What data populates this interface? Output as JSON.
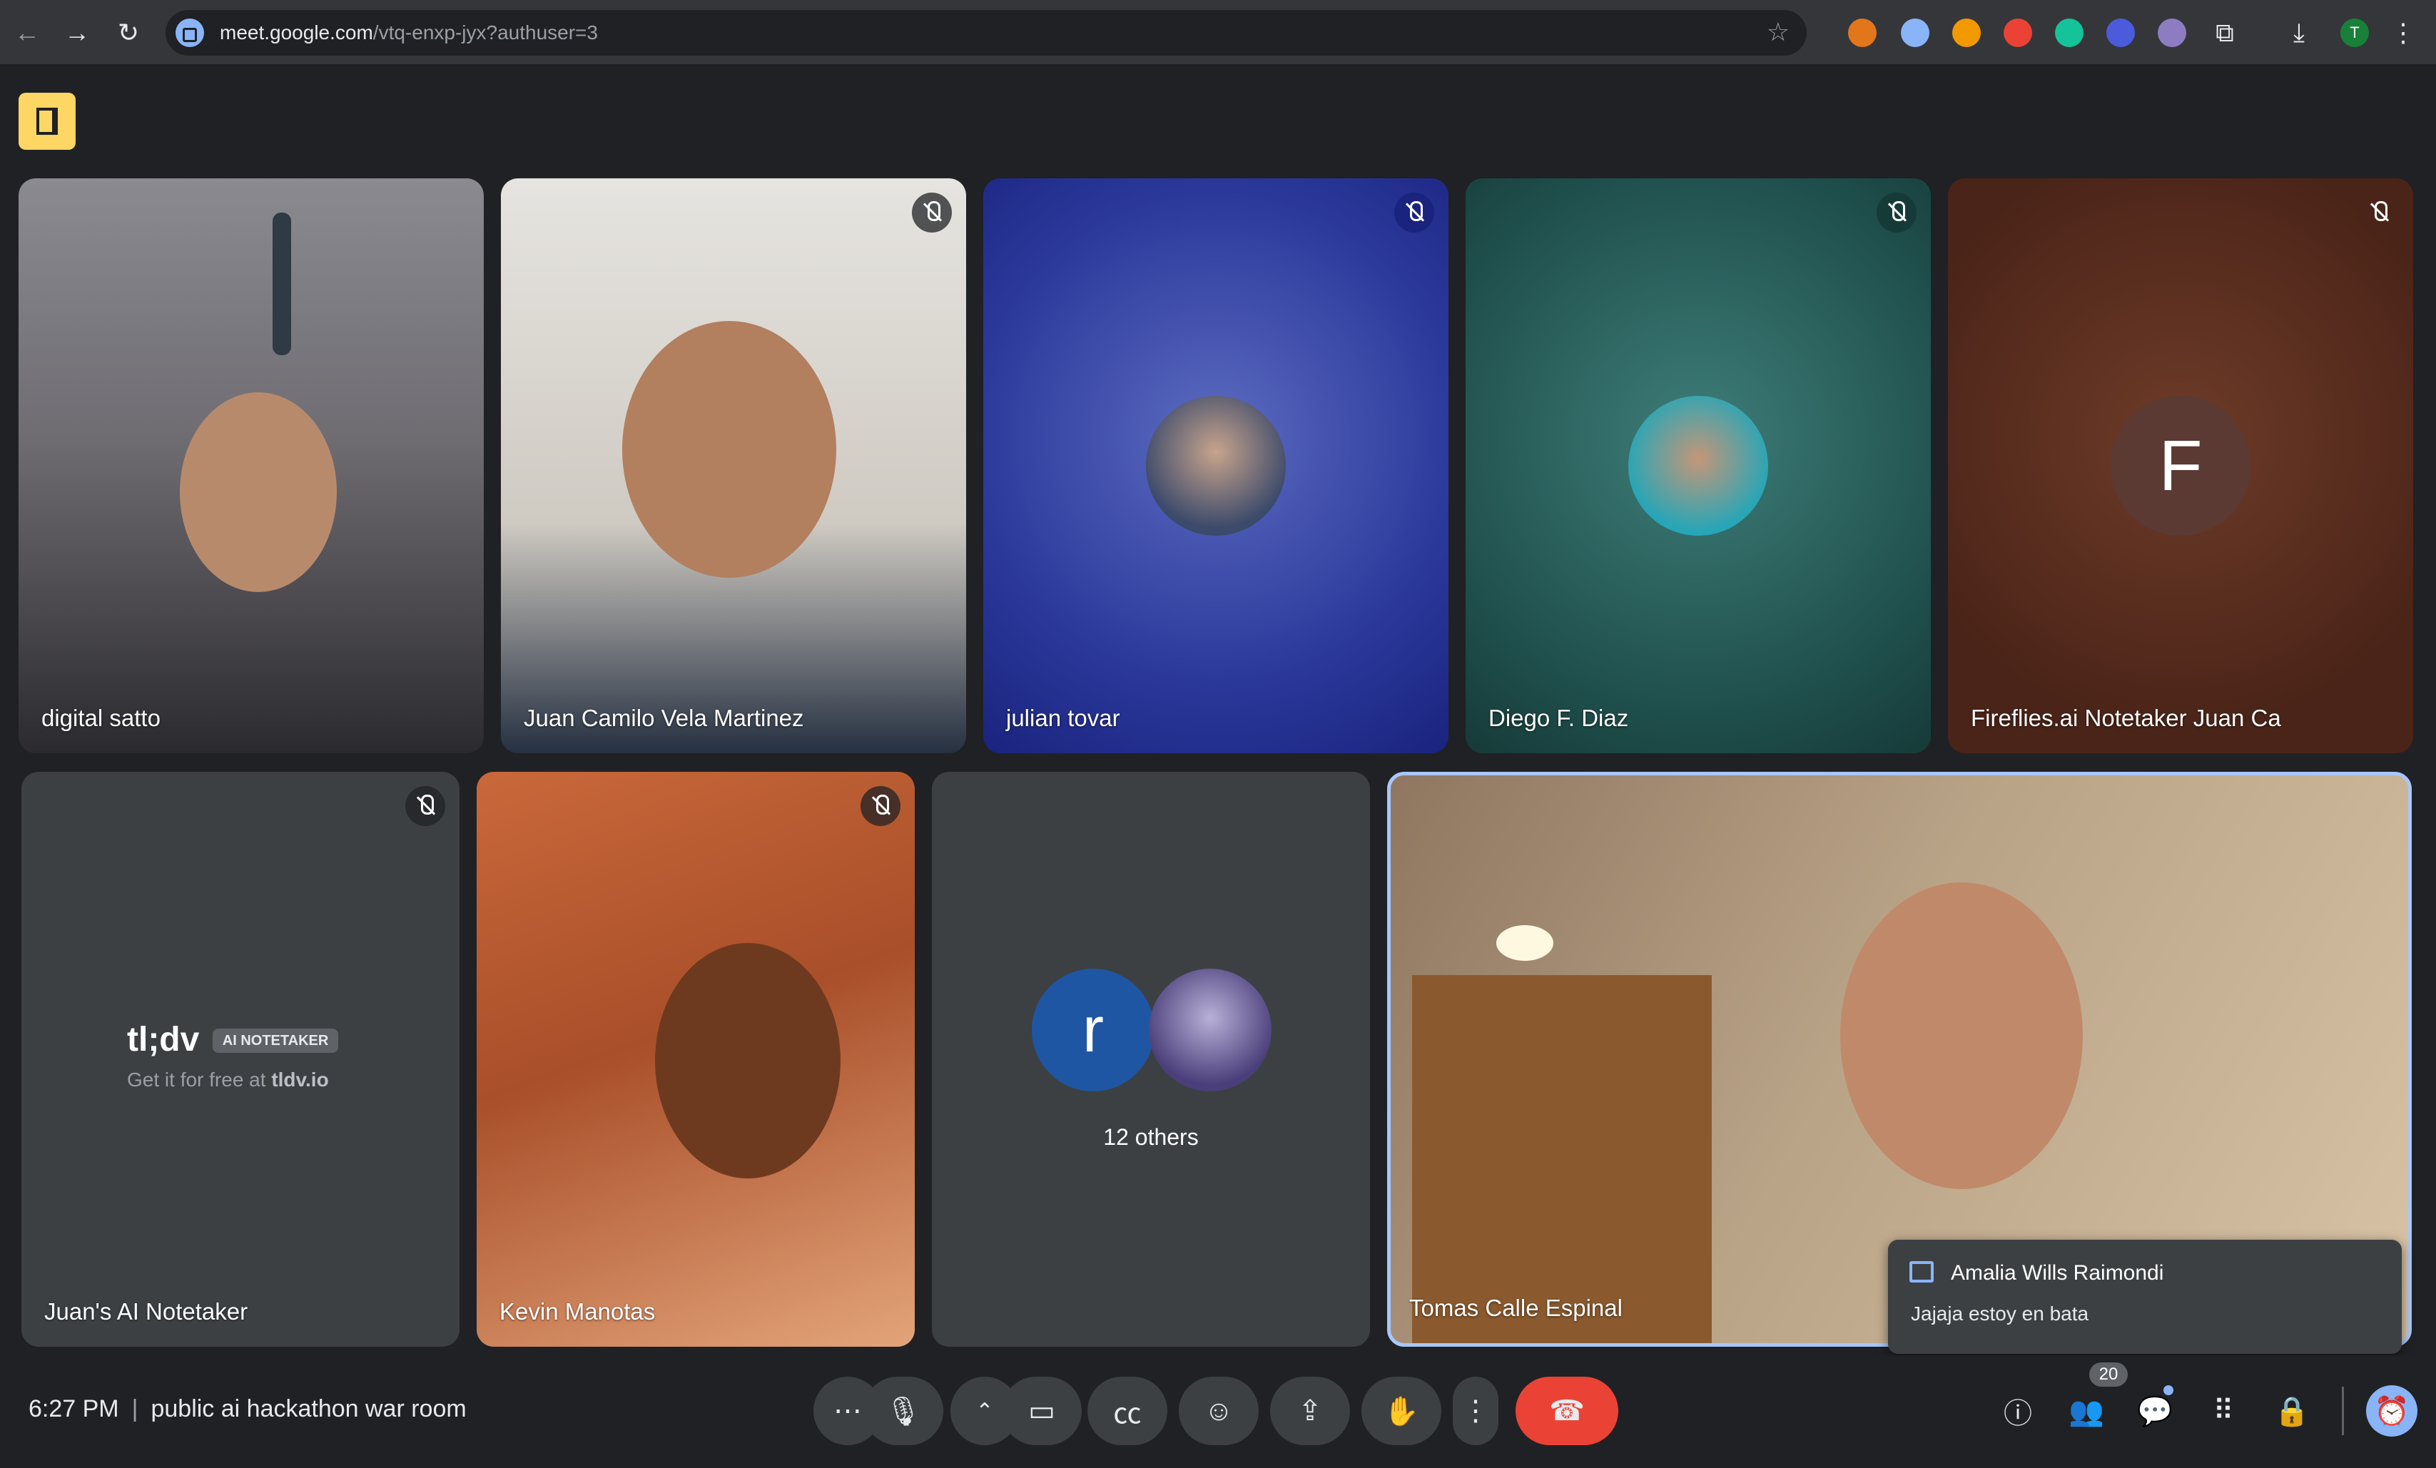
{
  "browser": {
    "url_host": "meet.google.com",
    "url_path": "/vtq-enxp-jyx?authuser=3",
    "profile_initial": "T"
  },
  "tiles": [
    {
      "name": "digital satto",
      "muted": false
    },
    {
      "name": "Juan Camilo Vela Martinez",
      "muted": true
    },
    {
      "name": "julian tovar",
      "muted": true
    },
    {
      "name": "Diego F. Diaz",
      "muted": true
    },
    {
      "name": "Fireflies.ai Notetaker Juan Ca",
      "muted": true,
      "avatar_letter": "F"
    },
    {
      "name": "Juan's AI Notetaker",
      "muted": true,
      "brand": "tl;dv",
      "brand_tag": "AI NOTETAKER",
      "brand_line": "Get it for free at ",
      "brand_link": "tldv.io"
    },
    {
      "name": "Kevin Manotas",
      "muted": true
    },
    {
      "name": "",
      "others_label": "12 others",
      "avatar_letter": "r"
    },
    {
      "name": "Tomas Calle Espinal",
      "muted": false
    }
  ],
  "toast": {
    "sender": "Amalia Wills Raimondi",
    "message": "Jajaja estoy en bata"
  },
  "meeting": {
    "time": "6:27 PM",
    "title": "public ai hackathon war room",
    "participant_count": "20"
  },
  "colors": {
    "end_call": "#ea4335",
    "door_button": "#fdd663",
    "accent": "#8ab4f8"
  }
}
